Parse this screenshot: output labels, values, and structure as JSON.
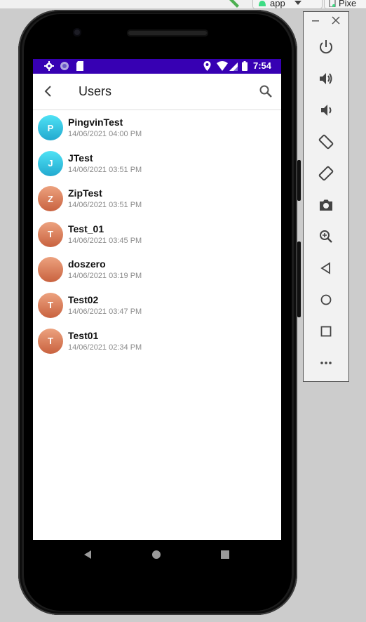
{
  "ide": {
    "run_config_label": "app",
    "device_label": "Pixe"
  },
  "status_bar": {
    "time": "7:54"
  },
  "app_bar": {
    "title": "Users"
  },
  "users": [
    {
      "initial": "P",
      "name": "PingvinTest",
      "date": "14/06/2021 04:00 PM",
      "color": "cyan"
    },
    {
      "initial": "J",
      "name": "JTest",
      "date": "14/06/2021 03:51 PM",
      "color": "cyan"
    },
    {
      "initial": "Z",
      "name": "ZipTest",
      "date": "14/06/2021 03:51 PM",
      "color": "orange"
    },
    {
      "initial": "T",
      "name": "Test_01",
      "date": "14/06/2021 03:45 PM",
      "color": "orange"
    },
    {
      "initial": "",
      "name": "doszero",
      "date": "14/06/2021 03:19 PM",
      "color": "orange"
    },
    {
      "initial": "T",
      "name": "Test02",
      "date": "14/06/2021 03:47 PM",
      "color": "orange"
    },
    {
      "initial": "T",
      "name": "Test01",
      "date": "14/06/2021 02:34 PM",
      "color": "orange"
    }
  ],
  "colors": {
    "status_bar": "#3700b3",
    "avatar_cyan": "#33c4e2",
    "avatar_orange": "#d9784f"
  },
  "emulator_panel": {
    "buttons": [
      "power-icon",
      "volume-up-icon",
      "volume-down-icon",
      "rotate-left-icon",
      "rotate-right-icon",
      "camera-icon",
      "zoom-icon",
      "back-icon",
      "home-icon",
      "overview-icon",
      "more-icon"
    ]
  }
}
